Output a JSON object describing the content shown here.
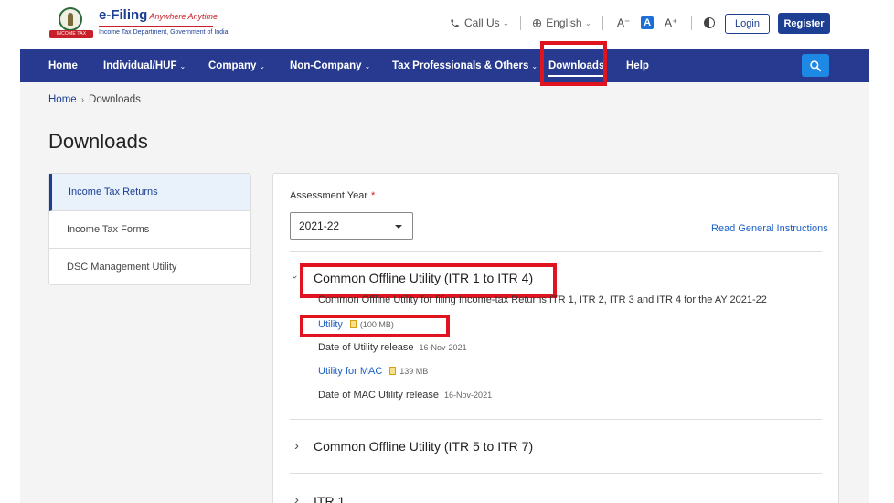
{
  "logo": {
    "title": "e-Filing",
    "tagline": "Anywhere Anytime",
    "subtitle": "Income Tax Department, Government of India",
    "ribbon": "INCOME TAX DEPARTMENT"
  },
  "utilities": {
    "call_us": "Call Us",
    "language": "English",
    "font_decrease": "A⁻",
    "font_normal": "A",
    "font_increase": "A⁺"
  },
  "auth": {
    "login": "Login",
    "register": "Register"
  },
  "nav": {
    "items": [
      {
        "label": "Home",
        "dropdown": false
      },
      {
        "label": "Individual/HUF",
        "dropdown": true
      },
      {
        "label": "Company",
        "dropdown": true
      },
      {
        "label": "Non-Company",
        "dropdown": true
      },
      {
        "label": "Tax Professionals & Others",
        "dropdown": true
      },
      {
        "label": "Downloads",
        "dropdown": false
      },
      {
        "label": "Help",
        "dropdown": false
      }
    ],
    "chev": "⌄"
  },
  "breadcrumb": {
    "home": "Home",
    "sep": "›",
    "current": "Downloads"
  },
  "page_title": "Downloads",
  "sidebar": {
    "items": [
      {
        "label": "Income Tax Returns"
      },
      {
        "label": "Income Tax Forms"
      },
      {
        "label": "DSC Management Utility"
      }
    ]
  },
  "assessment": {
    "label": "Assessment Year",
    "required": "*",
    "selected": "2021-22",
    "instructions": "Read General Instructions"
  },
  "accordion": [
    {
      "title": "Common Offline Utility (ITR 1 to ITR 4)",
      "chev": "⌵",
      "description": "Common Offline Utility for filing Income-tax Returns ITR 1, ITR 2, ITR 3 and ITR 4 for the AY 2021-22",
      "utility_label": "Utility",
      "utility_size": "(100 MB)",
      "release_label": "Date of Utility release",
      "release_date": "16-Nov-2021",
      "mac_label": "Utility for MAC",
      "mac_size": "139 MB",
      "mac_release_label": "Date of MAC Utility release",
      "mac_release_date": "16-Nov-2021"
    },
    {
      "title": "Common Offline Utility (ITR 5 to ITR 7)",
      "chev": "›"
    },
    {
      "title": "ITR 1",
      "chev": "›"
    }
  ],
  "colors": {
    "nav_bg": "#283a8f",
    "accent": "#1c3f94",
    "highlight": "#e0141e",
    "link": "#1c5fc4"
  }
}
